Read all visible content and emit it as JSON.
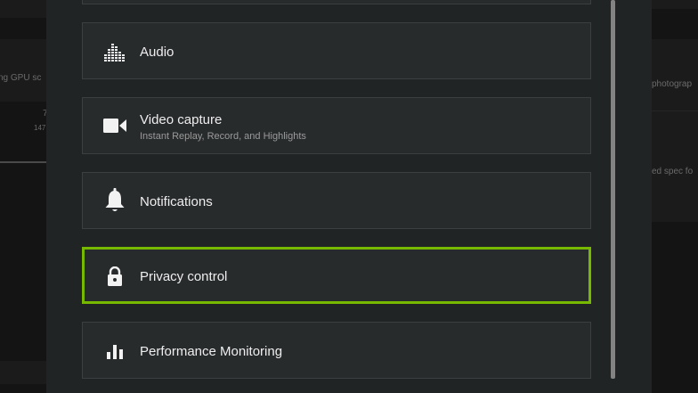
{
  "background": {
    "left_text": "ng GPU sc",
    "left_value": "7",
    "left_subvalue": "147",
    "right_text_1": "photograp",
    "right_text_2": "ed spec fo"
  },
  "settings": {
    "items": [
      {
        "label": "",
        "icon": ""
      },
      {
        "label": "Audio",
        "icon": "audio-equalizer-icon"
      },
      {
        "label": "Video capture",
        "sublabel": "Instant Replay, Record, and Highlights",
        "icon": "video-camera-icon"
      },
      {
        "label": "Notifications",
        "icon": "bell-icon"
      },
      {
        "label": "Privacy control",
        "icon": "lock-icon",
        "selected": true
      },
      {
        "label": "Performance Monitoring",
        "icon": "bar-chart-icon"
      }
    ]
  },
  "colors": {
    "accent": "#76b900",
    "panel": "#212425",
    "card": "#282b2c",
    "card_border": "#3b3f41",
    "text": "#eeeeee",
    "subtext": "#9a9a9a"
  }
}
